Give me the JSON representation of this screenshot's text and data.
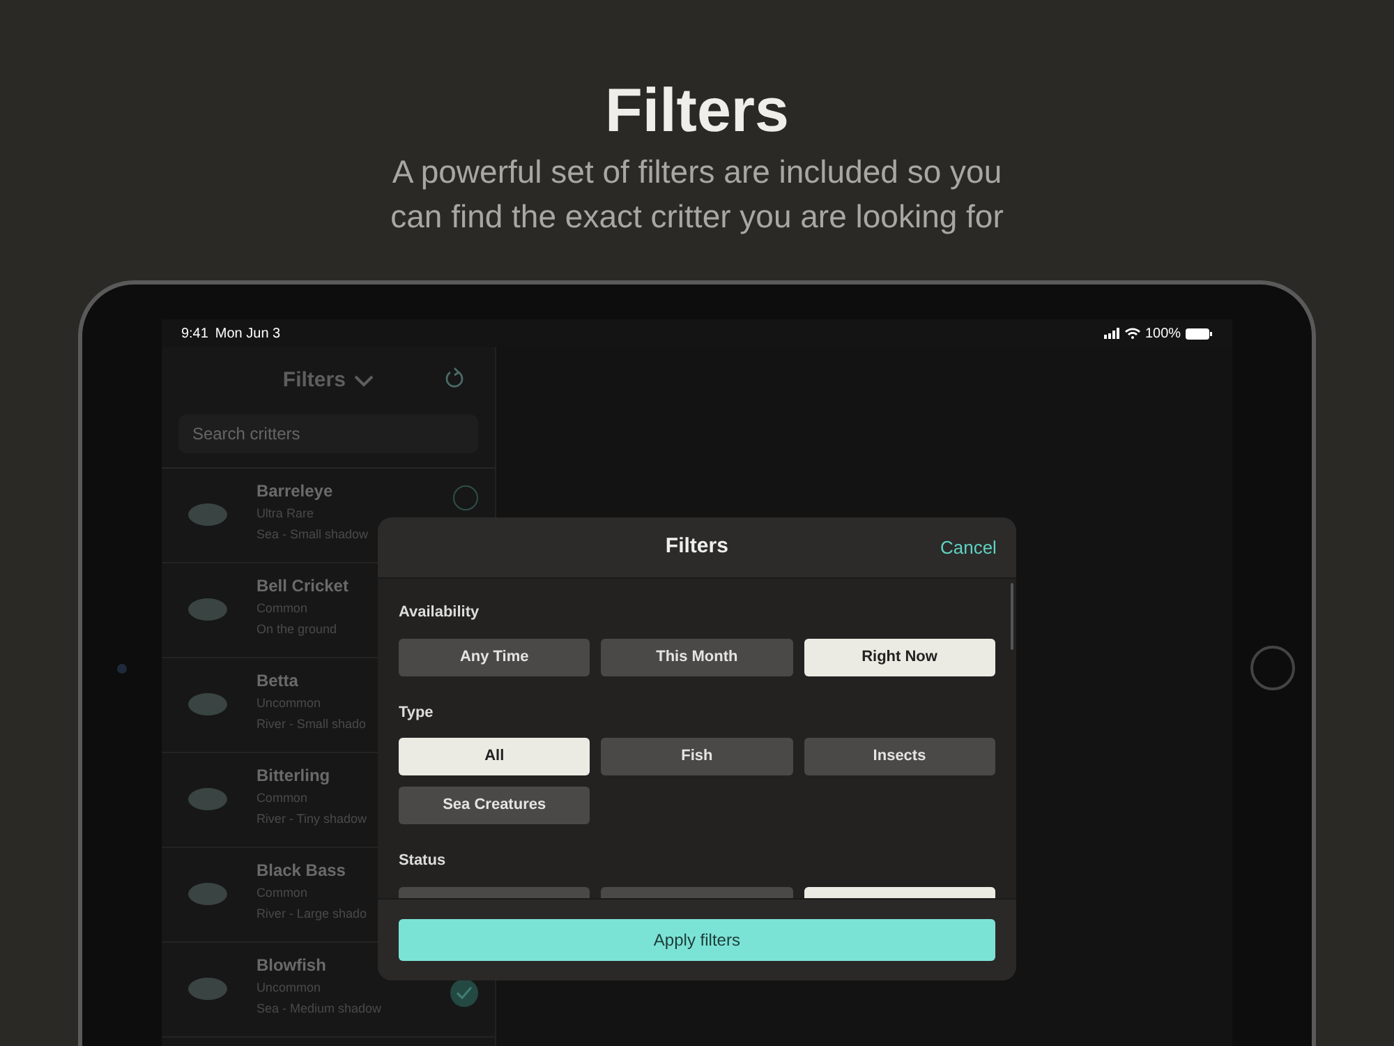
{
  "header": {
    "title": "Filters",
    "subtitle": "A powerful set of filters are included so you can find the exact critter you are looking for"
  },
  "status_bar": {
    "time": "9:41",
    "date": "Mon Jun 3",
    "battery": "100%"
  },
  "sidebar": {
    "title": "Filters",
    "search": {
      "placeholder": "Search critters"
    },
    "items": [
      {
        "name": "Barreleye",
        "rarity": "Ultra Rare",
        "detail": "Sea - Small shadow",
        "checked": false
      },
      {
        "name": "Bell Cricket",
        "rarity": "Common",
        "detail": "On the ground"
      },
      {
        "name": "Betta",
        "rarity": "Uncommon",
        "detail": "River - Small shado"
      },
      {
        "name": "Bitterling",
        "rarity": "Common",
        "detail": "River - Tiny shadow"
      },
      {
        "name": "Black Bass",
        "rarity": "Common",
        "detail": "River - Large shado"
      },
      {
        "name": "Blowfish",
        "rarity": "Uncommon",
        "detail": "Sea - Medium shadow",
        "checked": true
      }
    ]
  },
  "modal": {
    "title": "Filters",
    "cancel": "Cancel",
    "sections": [
      {
        "label": "Availability",
        "options": [
          {
            "label": "Any Time",
            "selected": false
          },
          {
            "label": "This Month",
            "selected": false
          },
          {
            "label": "Right Now",
            "selected": true
          }
        ]
      },
      {
        "label": "Type",
        "options": [
          {
            "label": "All",
            "selected": true
          },
          {
            "label": "Fish",
            "selected": false
          },
          {
            "label": "Insects",
            "selected": false
          },
          {
            "label": "Sea Creatures",
            "selected": false
          }
        ]
      },
      {
        "label": "Status",
        "options": [
          {
            "selected": false
          },
          {
            "selected": false
          },
          {
            "selected": true
          }
        ]
      }
    ],
    "apply": "Apply filters"
  }
}
